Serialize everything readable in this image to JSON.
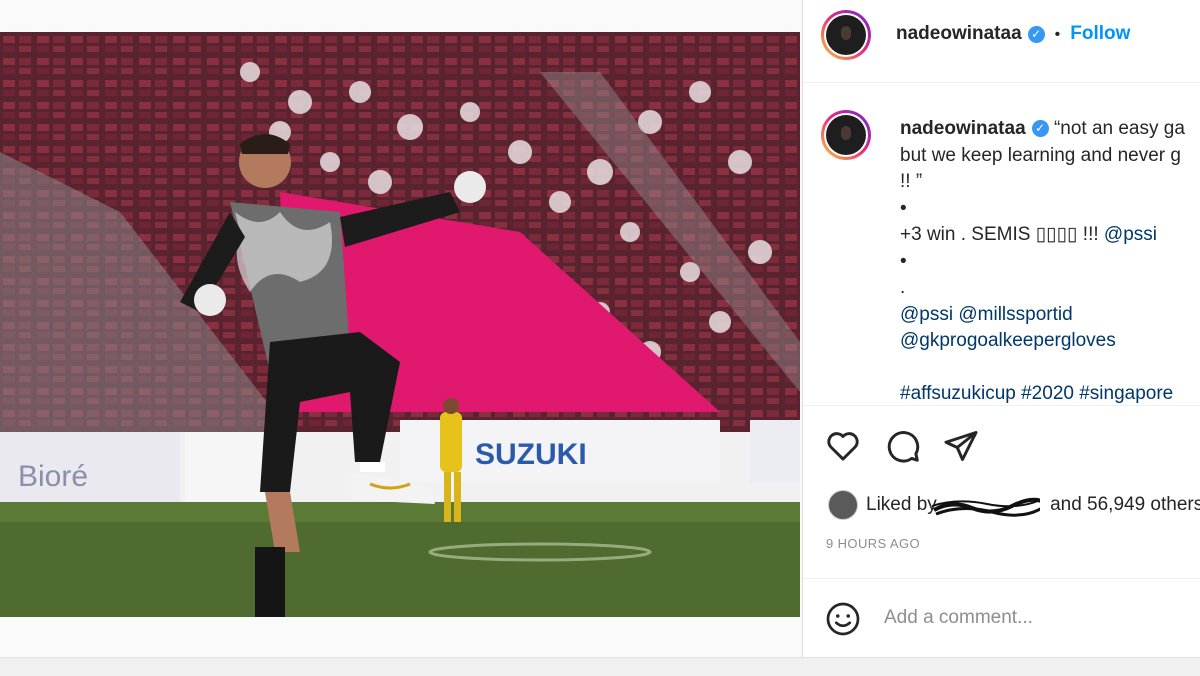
{
  "header": {
    "username": "nadeowinataa",
    "separator": "•",
    "follow_label": "Follow"
  },
  "caption": {
    "username": "nadeowinataa",
    "lines": [
      "“not an easy ga",
      "but we keep learning and never g",
      "!! ”",
      "•",
      "+3 win . SEMIS ▯▯▯▯ !!! ",
      "•",
      ".",
      "",
      "",
      "",
      "#affsuzukicup #2020 #singapore"
    ],
    "mention_line5": "@pssi",
    "tag_line8": "@pssi @millssportid",
    "tag_line9": "@gkprogoalkeepergloves"
  },
  "likes": {
    "prefix": "Liked by",
    "redacted_name": "",
    "suffix": "and 56,949 others"
  },
  "timestamp": "9 HOURS AGO",
  "comment": {
    "placeholder": "Add a comment..."
  },
  "photo": {
    "sponsor_text": "SUZUKI",
    "board_left": "Bioré"
  },
  "icons": {
    "like": "heart-icon",
    "comment": "comment-icon",
    "share": "paper-plane-icon",
    "emoji": "emoji-icon",
    "verified": "verified-badge-icon"
  },
  "colors": {
    "accent": "#0095f6",
    "verified": "#3897f0",
    "text": "#262626",
    "muted": "#8e8e8e"
  }
}
